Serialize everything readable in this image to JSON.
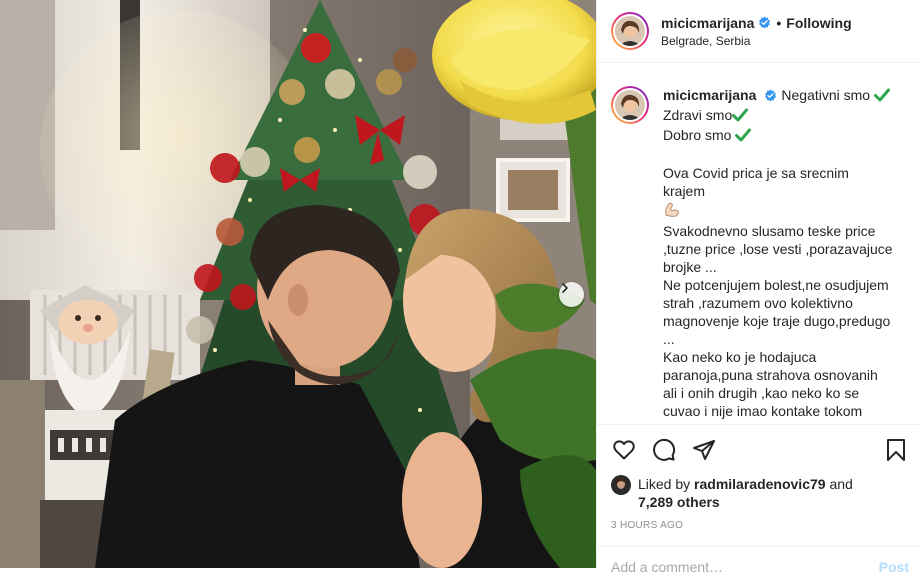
{
  "post": {
    "username": "micicmarijana",
    "follow_status": "Following",
    "separator": "•",
    "location": "Belgrade, Serbia",
    "caption": {
      "line1": "Negativni smo",
      "line2": "Zdravi smo",
      "line3": "Dobro smo",
      "line4": "Ova Covid prica je sa srecnim krajem",
      "body": "Svakodnevno slusamo teske price ,tuzne price ,lose vesti ,porazavajuce brojke ...\nNe potcenjujem bolest,ne osudjujem strah ,razumem ovo kolektivno magnovenje koje traje dugo,predugo ...\nKao neko ko je hodajuca paranoja,puna strahova osnovanih ali i onih drugih ,kao neko ko se cuvao i nije imao kontake tokom proteklih meseci ,zarazila sam se,tacnije zarazili smo se zajedno Milos i ja u istom"
    },
    "likes": {
      "prefix": "Liked by",
      "liker": "radmilaradenovic79",
      "conjunction": "and",
      "others": "7,289 others"
    },
    "timestamp": "3 HOURS AGO",
    "comment": {
      "placeholder": "Add a comment…",
      "post_label": "Post"
    }
  },
  "icons": {
    "verified": "verified-badge-icon",
    "check": "heavy-check-mark-icon",
    "muscle": "flexed-biceps-emoji",
    "like": "heart-outline-icon",
    "comment": "comment-bubble-icon",
    "share": "paper-plane-icon",
    "save": "bookmark-icon",
    "carousel": "chevron-right-icon"
  },
  "colors": {
    "verified": "#3897f0",
    "check": "#2da44e",
    "muted": "#8e8e8e",
    "post_button": "#b2dffc"
  }
}
